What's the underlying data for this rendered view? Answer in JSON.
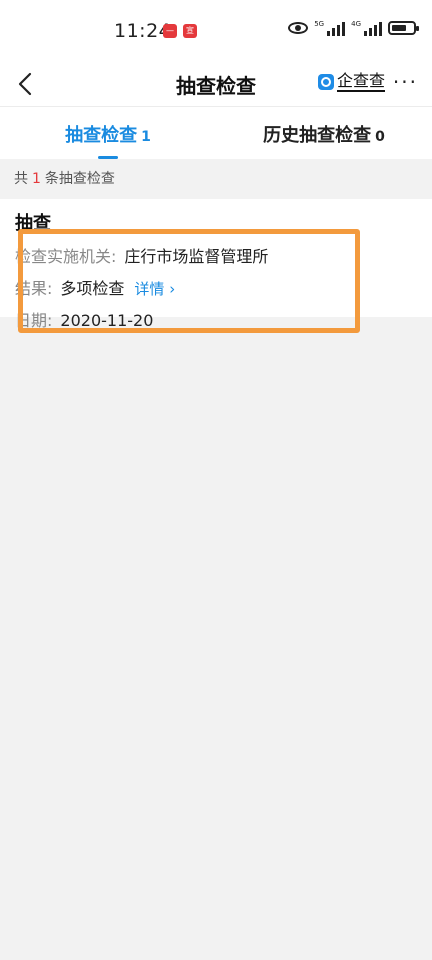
{
  "status_bar": {
    "time": "11:24",
    "badge1": "—",
    "badge2": "宣扬",
    "signal1_label": "5G",
    "signal2_label": "4G"
  },
  "header": {
    "title": "抽查检查",
    "brand_name": "企查查",
    "more": "···"
  },
  "tabs": [
    {
      "label": "抽查检查",
      "count": "1"
    },
    {
      "label": "历史抽查检查",
      "count": "0"
    }
  ],
  "summary": {
    "prefix": "共",
    "count": "1",
    "suffix": "条抽查检查"
  },
  "record": {
    "title": "抽查",
    "authority_label": "检查实施机关:",
    "authority_value": "庄行市场监督管理所",
    "result_label": "结果:",
    "result_value": "多项检查",
    "detail_link": "详情 ›",
    "date_label": "日期:",
    "date_value": "2020-11-20"
  },
  "colors": {
    "accent": "#1a8be0",
    "highlight": "#f39a3d",
    "count_red": "#e4393c"
  }
}
